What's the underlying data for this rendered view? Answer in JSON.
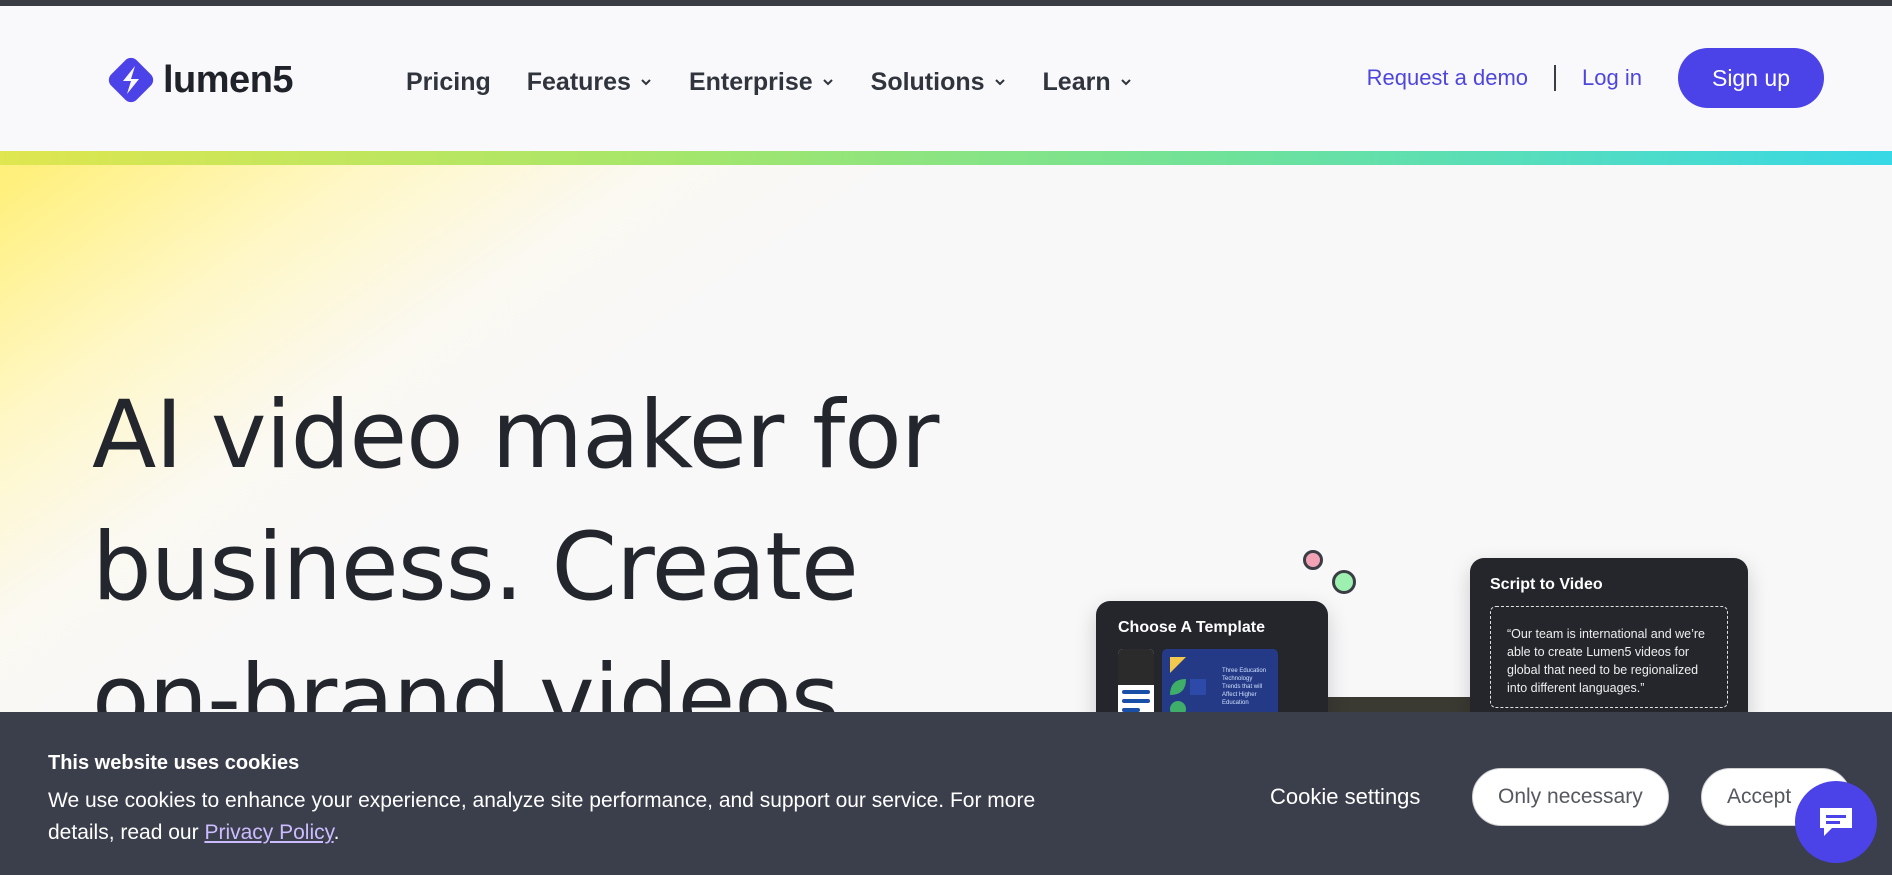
{
  "header": {
    "logo_text": "lumen5",
    "nav": [
      {
        "label": "Pricing",
        "has_dropdown": false
      },
      {
        "label": "Features",
        "has_dropdown": true
      },
      {
        "label": "Enterprise",
        "has_dropdown": true
      },
      {
        "label": "Solutions",
        "has_dropdown": true
      },
      {
        "label": "Learn",
        "has_dropdown": true
      }
    ],
    "request_demo": "Request a demo",
    "login": "Log in",
    "signup": "Sign up"
  },
  "hero": {
    "headline_lines": [
      "AI video maker for",
      "business. Create",
      "on-brand videos"
    ],
    "template_card": {
      "title": "Choose A Template",
      "thumb_text": "Three Education Technology Trends that will Affect Higher Education"
    },
    "script_card": {
      "title": "Script to Video",
      "quote": "“Our team is international and we’re able to create Lumen5 videos for global that need to be regionalized into different languages.”"
    }
  },
  "cookie": {
    "title": "This website uses cookies",
    "body": "We use cookies to enhance your experience, analyze site performance, and support our service. For more details, read our ",
    "link": "Privacy Policy",
    "end": ".",
    "settings": "Cookie settings",
    "necessary": "Only necessary",
    "accept": "Accept"
  },
  "colors": {
    "brand": "#4b42e8",
    "link": "#4e46dc",
    "banner": "#3b3e4b",
    "text_dark": "#22252c"
  },
  "icons": [
    "lumen5-logo-icon",
    "chevron-down-icon",
    "chat-icon"
  ]
}
